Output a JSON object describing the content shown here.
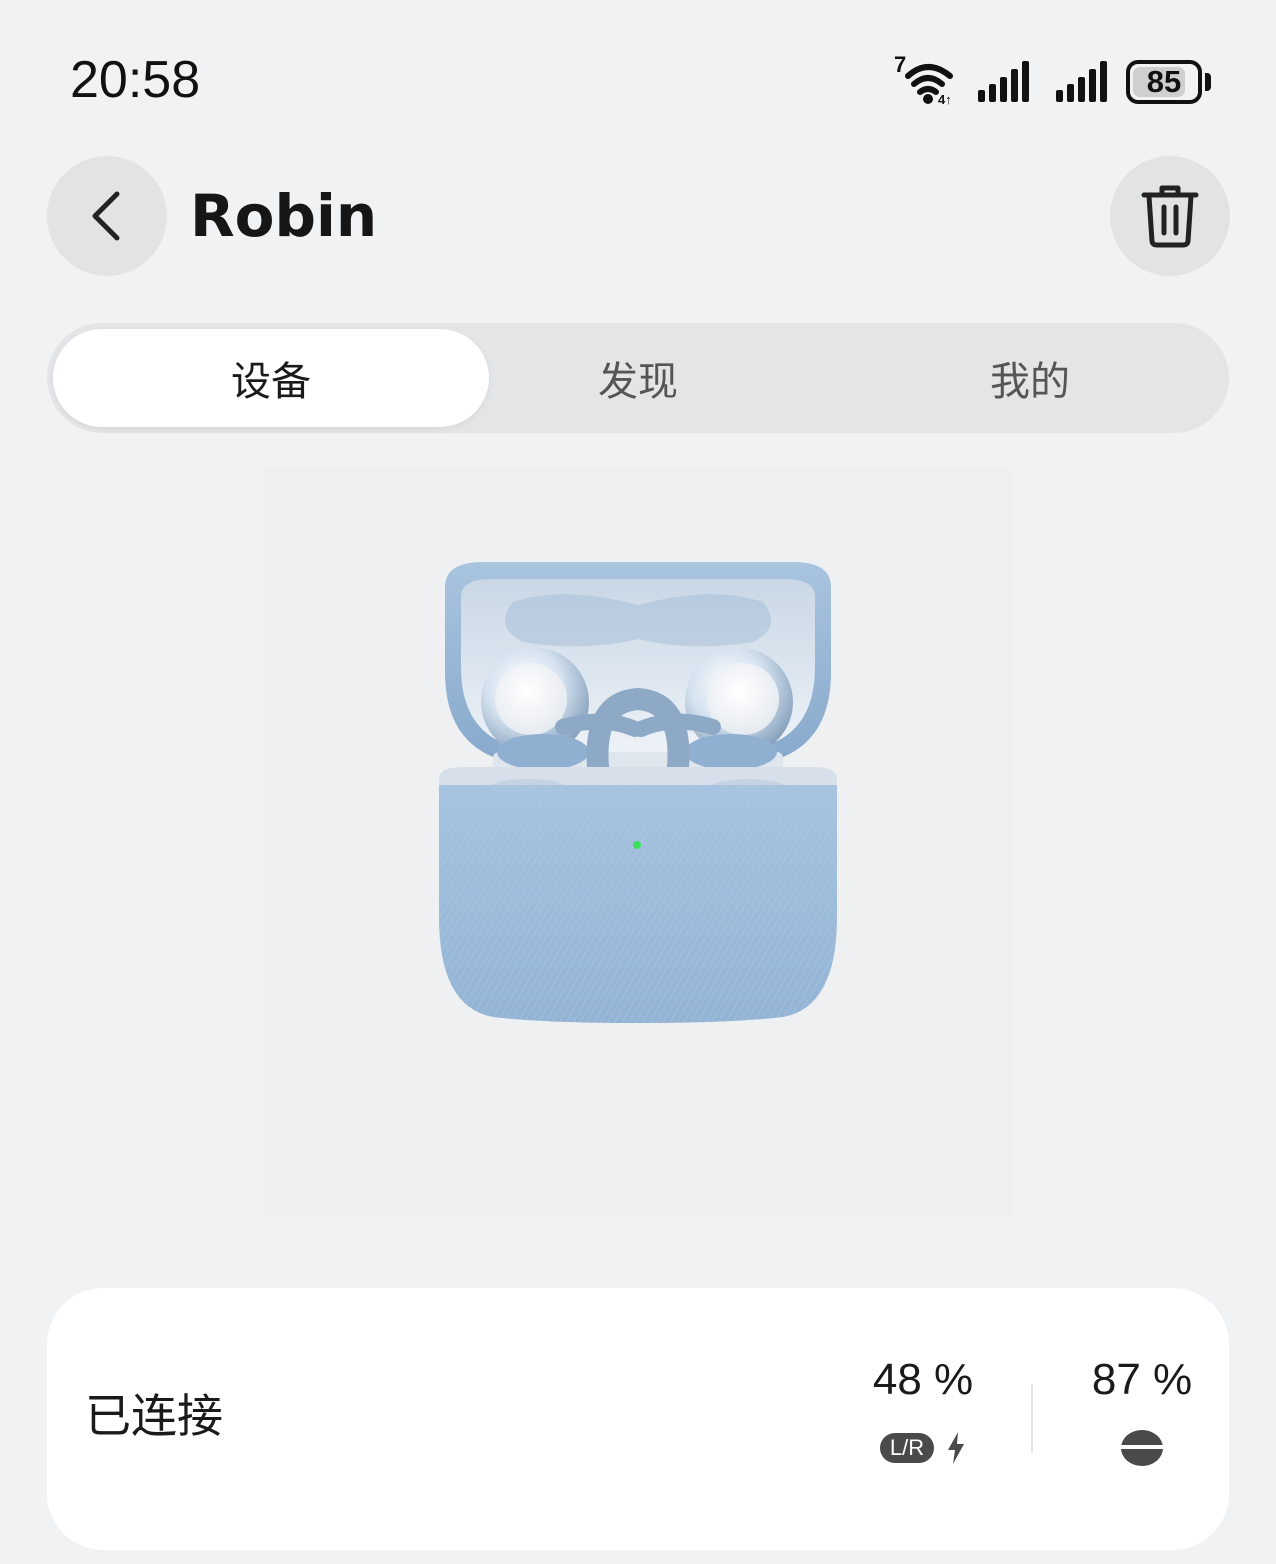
{
  "status_bar": {
    "time": "20:58",
    "wifi_badge": "7",
    "battery_percent": 85,
    "battery_label": "85"
  },
  "header": {
    "title": "Robin",
    "back_icon": "chevron-left-icon",
    "delete_icon": "trash-icon"
  },
  "tabs": [
    {
      "label": "设备",
      "active": true
    },
    {
      "label": "发现",
      "active": false
    },
    {
      "label": "我的",
      "active": false
    }
  ],
  "device": {
    "image": "earbuds-charging-case",
    "case_color": "#9dbbd8",
    "led_color": "#3ee05a"
  },
  "status_card": {
    "connection_label": "已连接",
    "earbuds": {
      "battery_value": "48 %",
      "badge": "L/R",
      "charging_icon": "lightning-icon"
    },
    "case": {
      "battery_value": "87 %",
      "icon": "charging-case-icon"
    }
  }
}
